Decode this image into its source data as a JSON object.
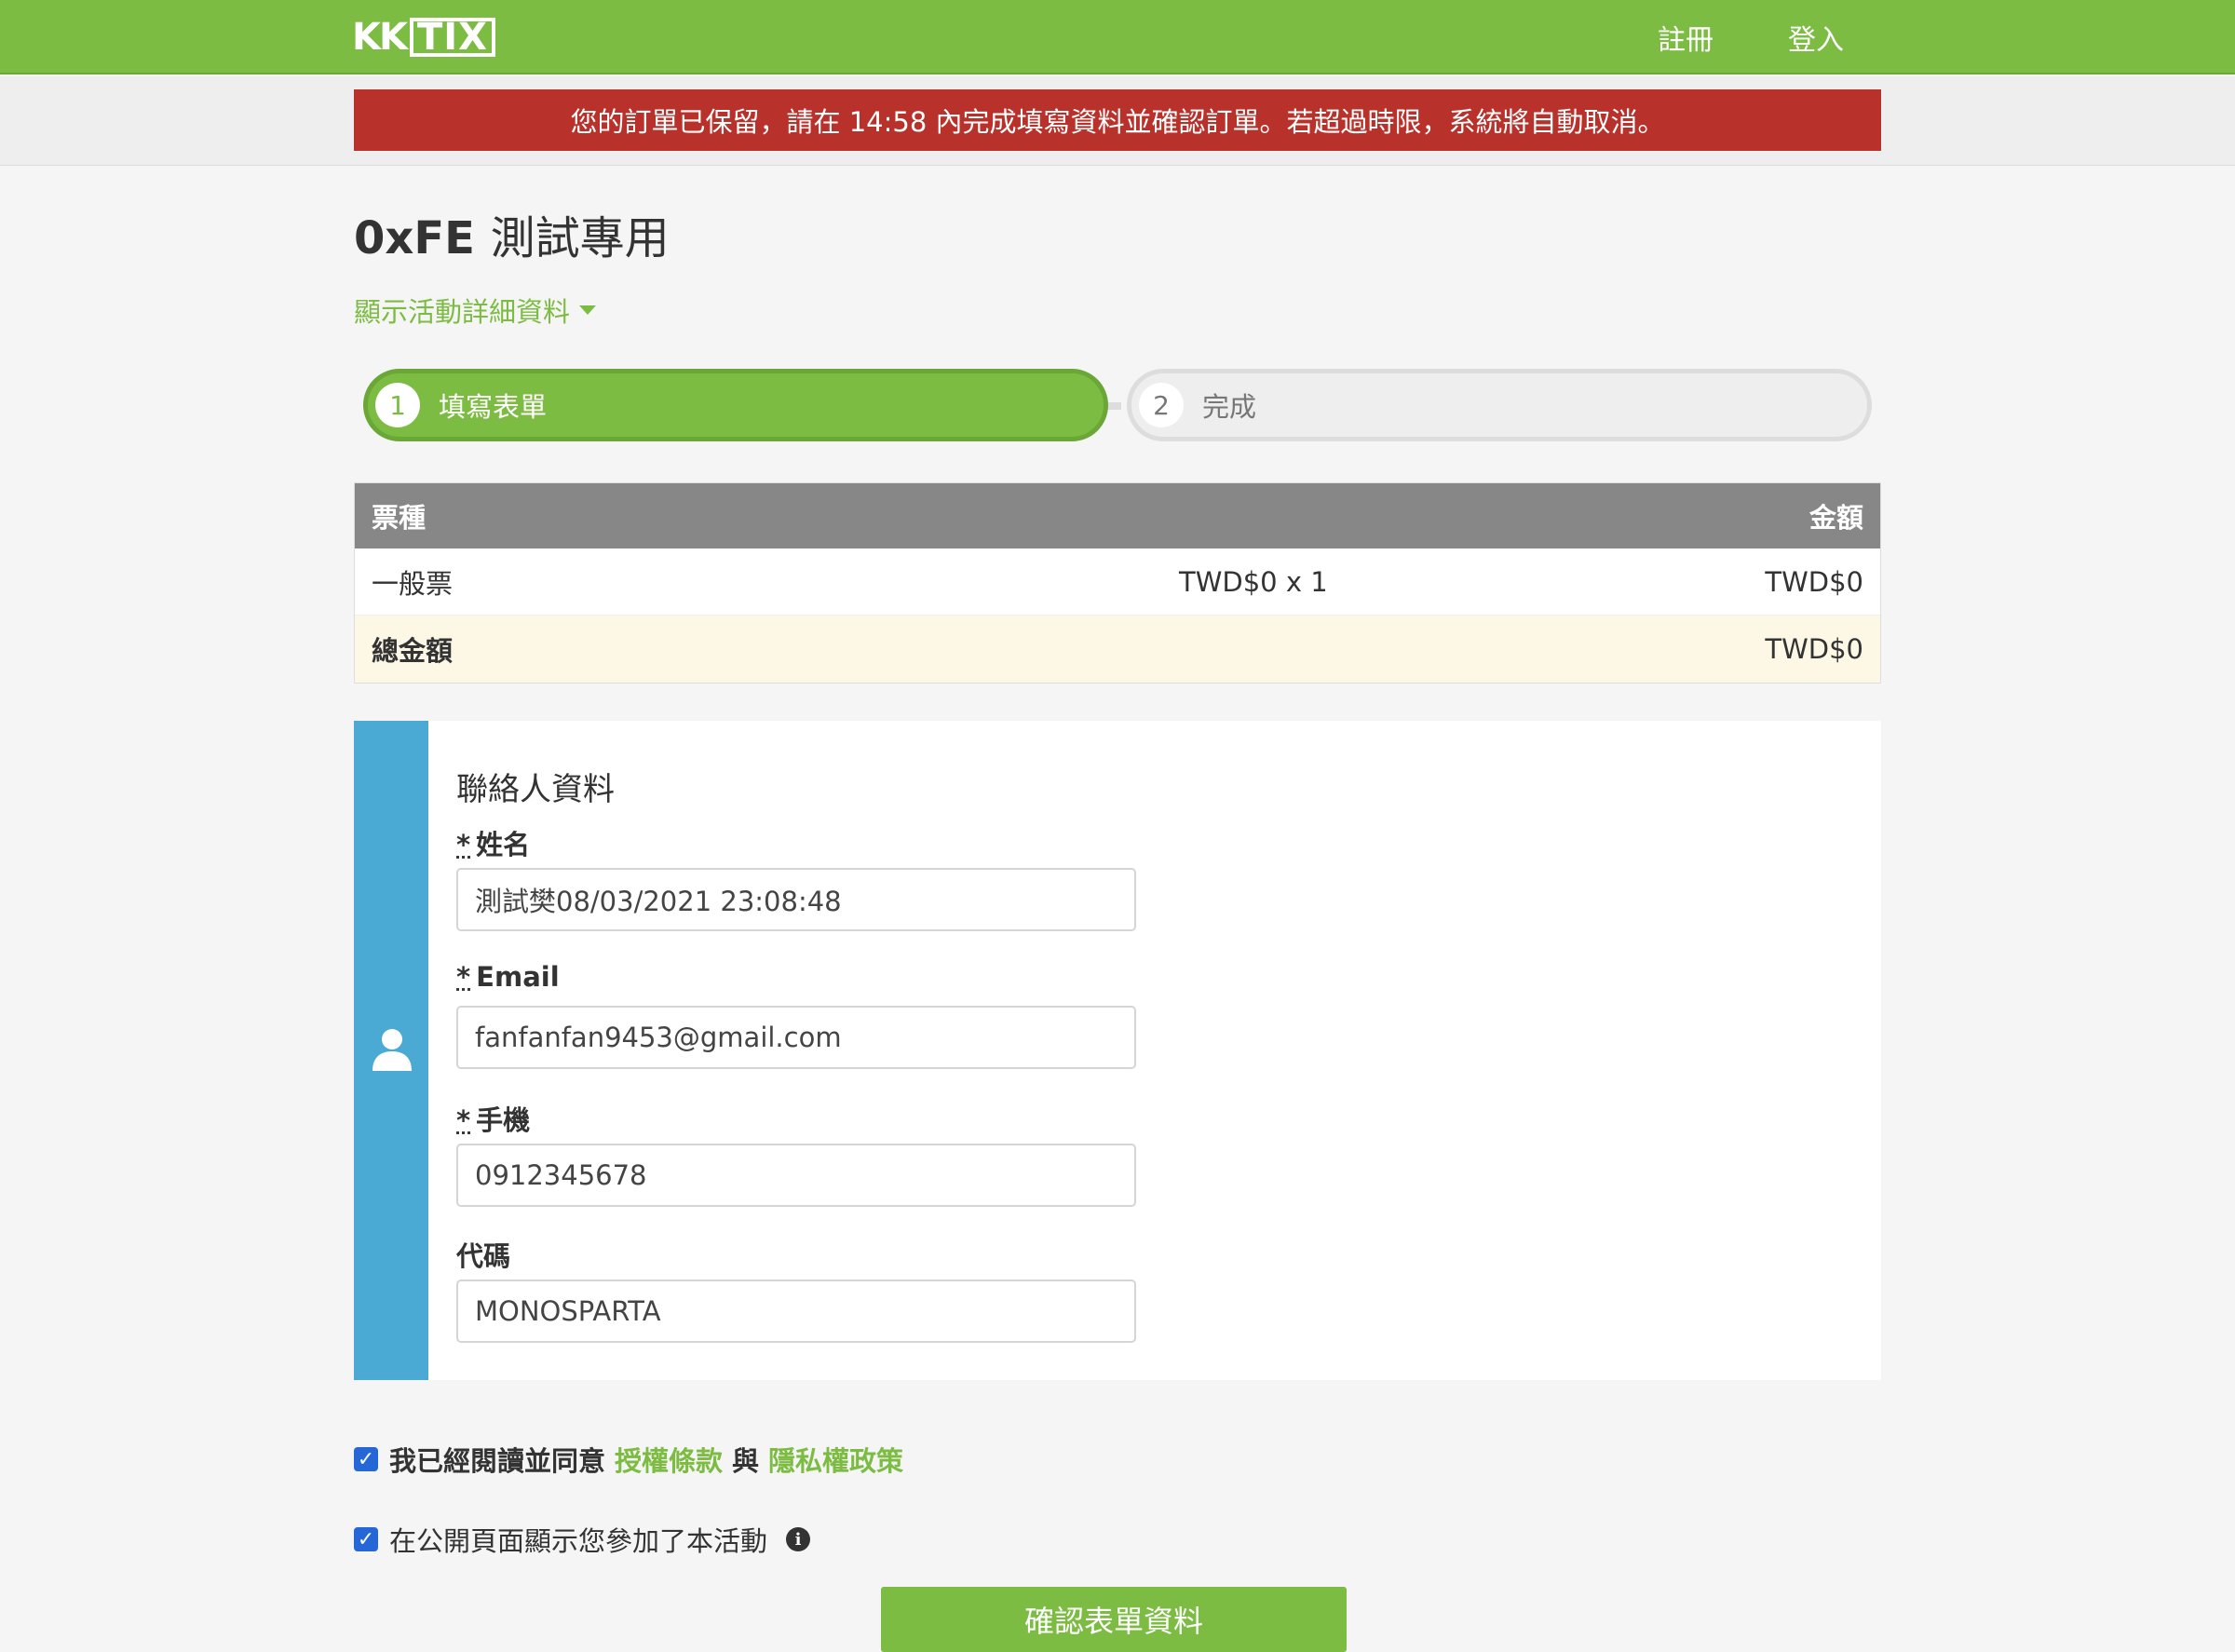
{
  "header": {
    "logo_kk": "KK",
    "logo_tix": "TIX",
    "register_label": "註冊",
    "login_label": "登入"
  },
  "notice": "您的訂單已保留，請在 14:58 內完成填寫資料並確認訂單。若超過時限，系統將自動取消。",
  "event": {
    "title_prefix": "0xFE",
    "title_suffix": "測試專用",
    "details_link": "顯示活動詳細資料"
  },
  "steps": [
    {
      "num": "1",
      "label": "填寫表單"
    },
    {
      "num": "2",
      "label": "完成"
    }
  ],
  "ticket_table": {
    "col_ticket": "票種",
    "col_amount": "金額",
    "rows": [
      {
        "name": "一般票",
        "qty": "TWD$0 x 1",
        "amount": "TWD$0"
      }
    ],
    "total_label": "總金額",
    "total_amount": "TWD$0"
  },
  "contact": {
    "title": "聯絡人資料",
    "required_mark": "*",
    "fields": [
      {
        "label": "姓名",
        "value": "測試樊08/03/2021 23:08:48",
        "required": true
      },
      {
        "label": "Email",
        "value": "fanfanfan9453@gmail.com",
        "required": true
      },
      {
        "label": "手機",
        "value": "0912345678",
        "required": true
      },
      {
        "label": "代碼",
        "value": "MONOSPARTA",
        "required": false
      }
    ]
  },
  "agreement": {
    "prefix": "我已經閱讀並同意",
    "terms_link": "授權條款",
    "and": "與",
    "privacy_link": "隱私權政策"
  },
  "public_display": {
    "label": "在公開頁面顯示您參加了本活動"
  },
  "submit_label": "確認表單資料",
  "colors": {
    "brand_green": "#7dbc42",
    "notice_red": "#b8312a",
    "contact_blue": "#4aaad4",
    "checkbox_blue": "#2667d8"
  }
}
